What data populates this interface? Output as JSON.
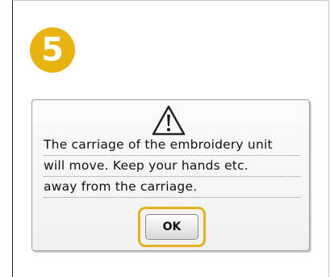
{
  "step": {
    "number": "5",
    "color": "#e8b30e"
  },
  "dialog": {
    "icon": "warning-icon",
    "message_lines": [
      "The carriage of the embroidery unit",
      "will move. Keep your hands etc.",
      "away from the carriage."
    ],
    "ok_label": "OK",
    "highlight_color": "#e3b21c"
  }
}
